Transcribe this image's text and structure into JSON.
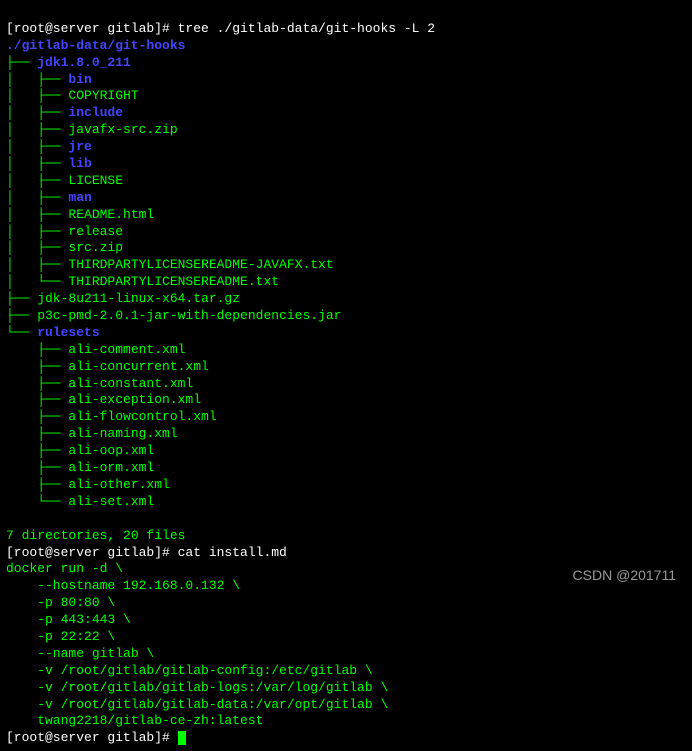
{
  "lines": {
    "l0": "[root@server gitlab]# tree ./gitlab-data/git-hooks -L 2",
    "l1a": "./gitlab-data/git-hooks",
    "l2a": "├── ",
    "l2b": "jdk1.8.0_211",
    "l3a": "│   ├── ",
    "l3b": "bin",
    "l4": "│   ├── COPYRIGHT",
    "l5a": "│   ├── ",
    "l5b": "include",
    "l6": "│   ├── javafx-src.zip",
    "l7a": "│   ├── ",
    "l7b": "jre",
    "l8a": "│   ├── ",
    "l8b": "lib",
    "l9": "│   ├── LICENSE",
    "l10a": "│   ├── ",
    "l10b": "man",
    "l11": "│   ├── README.html",
    "l12": "│   ├── release",
    "l13": "│   ├── src.zip",
    "l14": "│   ├── THIRDPARTYLICENSEREADME-JAVAFX.txt",
    "l15": "│   └── THIRDPARTYLICENSEREADME.txt",
    "l16": "├── jdk-8u211-linux-x64.tar.gz",
    "l17": "├── p3c-pmd-2.0.1-jar-with-dependencies.jar",
    "l18a": "└── ",
    "l18b": "rulesets",
    "l19": "    ├── ali-comment.xml",
    "l20": "    ├── ali-concurrent.xml",
    "l21": "    ├── ali-constant.xml",
    "l22": "    ├── ali-exception.xml",
    "l23": "    ├── ali-flowcontrol.xml",
    "l24": "    ├── ali-naming.xml",
    "l25": "    ├── ali-oop.xml",
    "l26": "    ├── ali-orm.xml",
    "l27": "    ├── ali-other.xml",
    "l28": "    └── ali-set.xml",
    "l29": " ",
    "l30": "7 directories, 20 files",
    "l31": "[root@server gitlab]# cat install.md",
    "l32": "docker run -d \\",
    "l33": "    --hostname 192.168.0.132 \\",
    "l34": "    -p 80:80 \\",
    "l35": "    -p 443:443 \\",
    "l36": "    -p 22:22 \\",
    "l37": "    --name gitlab \\",
    "l38": "    -v /root/gitlab/gitlab-config:/etc/gitlab \\",
    "l39": "    -v /root/gitlab/gitlab-logs:/var/log/gitlab \\",
    "l40": "    -v /root/gitlab/gitlab-data:/var/opt/gitlab \\",
    "l41": "    twang2218/gitlab-ce-zh:latest",
    "l42": "[root@server gitlab]# "
  },
  "watermark": "CSDN @201711"
}
